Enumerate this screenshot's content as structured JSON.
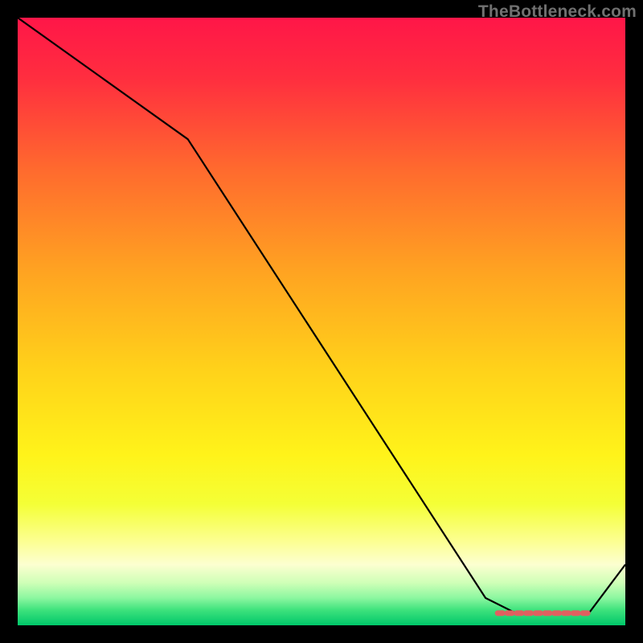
{
  "watermark": "TheBottleneck.com",
  "chart_data": {
    "type": "line",
    "x": [
      0,
      0.28,
      0.77,
      0.82,
      0.94,
      1.0
    ],
    "values": [
      1.0,
      0.8,
      0.045,
      0.02,
      0.02,
      0.1
    ],
    "title": "",
    "xlabel": "",
    "ylabel": "",
    "xlim": [
      0,
      1
    ],
    "ylim": [
      0,
      1
    ],
    "marker_segment": {
      "x0": 0.79,
      "x1": 0.93,
      "y": 0.02
    },
    "gradient_stops": [
      {
        "offset": 0.0,
        "color": "#ff1648"
      },
      {
        "offset": 0.1,
        "color": "#ff2e3f"
      },
      {
        "offset": 0.25,
        "color": "#ff6a2e"
      },
      {
        "offset": 0.42,
        "color": "#ffa421"
      },
      {
        "offset": 0.58,
        "color": "#ffd21a"
      },
      {
        "offset": 0.72,
        "color": "#fff31a"
      },
      {
        "offset": 0.8,
        "color": "#f4ff36"
      },
      {
        "offset": 0.86,
        "color": "#fcff8f"
      },
      {
        "offset": 0.9,
        "color": "#fcffd0"
      },
      {
        "offset": 0.93,
        "color": "#cfffb7"
      },
      {
        "offset": 0.955,
        "color": "#8cf7a0"
      },
      {
        "offset": 0.975,
        "color": "#3de27c"
      },
      {
        "offset": 1.0,
        "color": "#00c76a"
      }
    ]
  }
}
